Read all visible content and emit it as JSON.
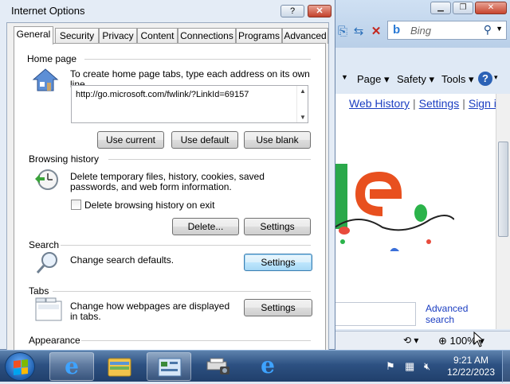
{
  "dialog": {
    "title": "Internet Options",
    "help_label": "?",
    "close_label": "✕",
    "tabs": [
      {
        "label": "General"
      },
      {
        "label": "Security"
      },
      {
        "label": "Privacy"
      },
      {
        "label": "Content"
      },
      {
        "label": "Connections"
      },
      {
        "label": "Programs"
      },
      {
        "label": "Advanced"
      }
    ],
    "home_page": {
      "heading": "Home page",
      "description": "To create home page tabs, type each address on its own line.",
      "url": "http://go.microsoft.com/fwlink/?LinkId=69157",
      "buttons": [
        "Use current",
        "Use default",
        "Use blank"
      ]
    },
    "browsing_history": {
      "heading": "Browsing history",
      "description": "Delete temporary files, history, cookies, saved passwords, and web form information.",
      "checkbox_label": "Delete browsing history on exit",
      "checkbox_checked": false,
      "delete_label": "Delete...",
      "settings_label": "Settings"
    },
    "search": {
      "heading": "Search",
      "description": "Change search defaults.",
      "settings_label": "Settings"
    },
    "tabs_section": {
      "heading": "Tabs",
      "description": "Change how webpages are displayed in tabs.",
      "settings_label": "Settings"
    },
    "appearance": {
      "heading": "Appearance"
    }
  },
  "browser": {
    "search_placeholder": "Bing",
    "commands": [
      "Page",
      "Safety",
      "Tools"
    ],
    "links": [
      "Web History",
      "Settings",
      "Sign in"
    ],
    "advanced_search": "Advanced search",
    "zoom": "100%",
    "doodle_letters": "le"
  },
  "taskbar": {
    "time": "9:21 AM",
    "date": "12/22/2023"
  },
  "colors": {
    "title_blue": "#dfe8f4",
    "close_red": "#c7452f",
    "link_blue": "#1a3dc1",
    "taskbar": "#2d5182"
  }
}
